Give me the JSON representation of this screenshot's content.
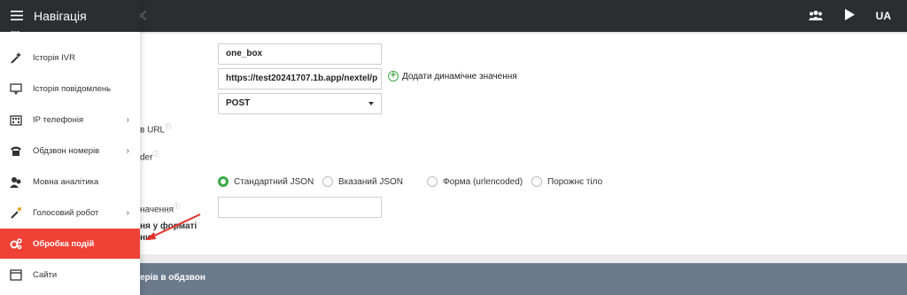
{
  "topbar": {
    "lang": "UA"
  },
  "nav": {
    "title": "Навігація",
    "items": [
      {
        "label": "Історія IVR",
        "icon": "magic-wand-icon",
        "chevron": false,
        "active": false
      },
      {
        "label": "Історія повідомлень",
        "icon": "message-icon",
        "chevron": false,
        "active": false
      },
      {
        "label": "IP телефонія",
        "icon": "building-icon",
        "chevron": true,
        "active": false
      },
      {
        "label": "Обдзвон номерів",
        "icon": "phone-icon",
        "chevron": true,
        "active": false
      },
      {
        "label": "Мовна аналітика",
        "icon": "users-icon",
        "chevron": false,
        "active": false
      },
      {
        "label": "Голосовий робот",
        "icon": "wand-icon",
        "chevron": true,
        "active": false
      },
      {
        "label": "Обробка подій",
        "icon": "gears-icon",
        "chevron": false,
        "active": true
      },
      {
        "label": "Сайти",
        "icon": "window-icon",
        "chevron": false,
        "active": false
      }
    ]
  },
  "form": {
    "name_value": "one_box",
    "url_value": "https://test20241707.1b.app/nextel/p",
    "add_dynamic_label": "Додати динамічне значення",
    "method_value": "POST",
    "label_url_partial": "в URL",
    "label_header_partial": "der",
    "label_value_partial": "начення",
    "label_json_line1": "ня у форматі",
    "label_json_line2": "ни",
    "extra_value": "",
    "radios": [
      {
        "label": "Стандартний JSON",
        "checked": true
      },
      {
        "label": "Вказаний JSON",
        "checked": false
      },
      {
        "label": "Форма (urlencoded)",
        "checked": false
      },
      {
        "label": "Порожнє тіло",
        "checked": false
      }
    ]
  },
  "footer": {
    "text": "ерів в обдзвон"
  },
  "colors": {
    "accent_green": "#3aa845",
    "active_red": "#f04137",
    "topbar": "#2b2d31",
    "footer": "#6b7a8c"
  }
}
